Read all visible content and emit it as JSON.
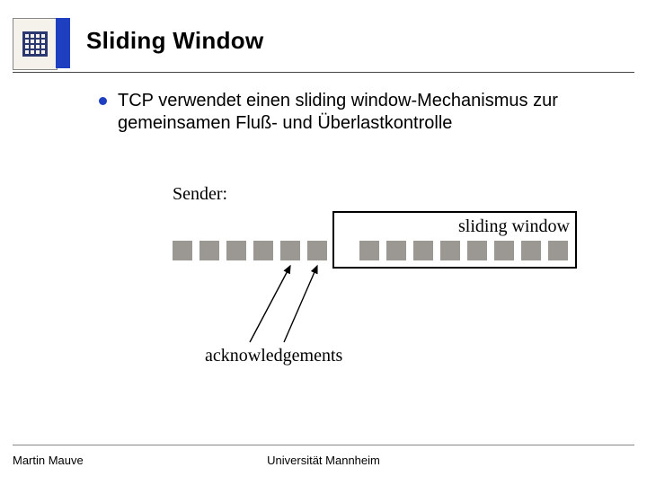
{
  "header": {
    "title": "Sliding Window"
  },
  "bullet": {
    "text": "TCP verwendet einen sliding window-Mechanismus zur gemeinsamen Fluß- und Überlastkontrolle"
  },
  "diagram": {
    "sender_label": "Sender:",
    "window_caption": "sliding window",
    "ack_label": "acknowledgements"
  },
  "footer": {
    "author": "Martin Mauve",
    "affiliation": "Universität Mannheim"
  }
}
